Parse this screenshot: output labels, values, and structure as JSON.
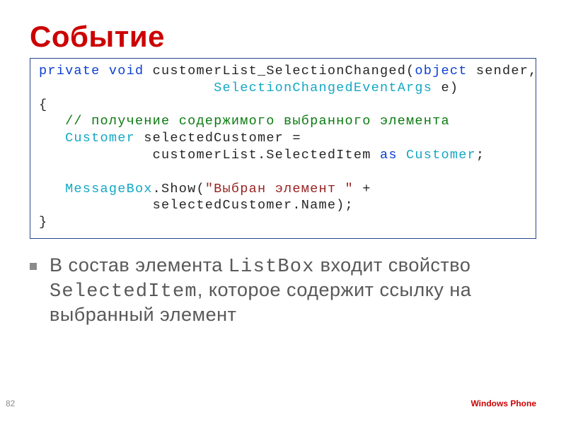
{
  "title": "Событие",
  "code": {
    "kw_private": "private",
    "kw_void": "void",
    "fn_name": " customerList_SelectionChanged(",
    "kw_object": "object",
    "p_sender": " sender,",
    "indent_args": "                    ",
    "typ_args": "SelectionChangedEventArgs",
    "p_e": " e)",
    "brace_open": "{",
    "cmt_line": "   // получение содержимого выбранного элемента",
    "indent3": "   ",
    "typ_customer": "Customer",
    "decl": " selectedCustomer =",
    "line_selected": "             customerList.SelectedItem ",
    "kw_as": "as",
    "typ_customer2": "Customer",
    "semicolon": ";",
    "blank": "   ",
    "typ_msgbox": "MessageBox",
    "show": ".Show(",
    "str_lit": "\"Выбран элемент \"",
    "plus": " +",
    "line_name": "             selectedCustomer.Name);",
    "brace_close": "}"
  },
  "body": {
    "text_pre": "В состав элемента ",
    "mono1": "ListBox",
    "text_mid1": " входит свойство ",
    "mono2": "SelectedItem",
    "text_post": ", которое содержит ссылку на выбранный элемент"
  },
  "page_number": "82",
  "brand": "Windows Phone"
}
